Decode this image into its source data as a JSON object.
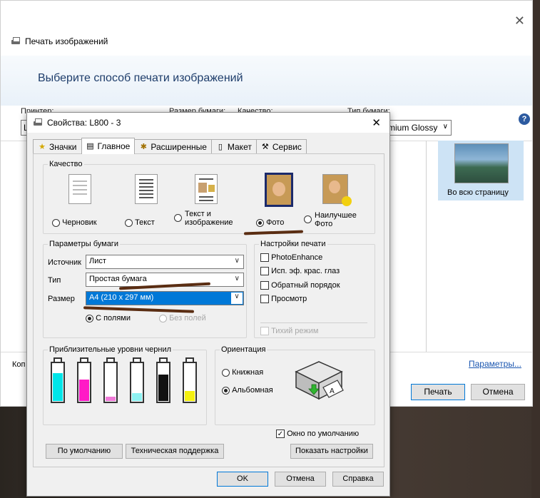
{
  "back_window": {
    "title": "Печать изображений",
    "heading": "Выберите способ печати изображений",
    "labels": {
      "printer": "Принтер:",
      "paper_size": "Размер бумаги:",
      "quality": "Качество:",
      "paper_type": "Тип бумаги:"
    },
    "printer_value_partial": "L",
    "paper_type_value": "mium Glossy",
    "layout_option": "Во всю страницу",
    "copies_label": "Коп",
    "params_link": "Параметры...",
    "print_button": "Печать",
    "cancel_button": "Отмена"
  },
  "props": {
    "title": "Свойства: L800 - 3",
    "tabs": [
      "Значки",
      "Главное",
      "Расширенные",
      "Макет",
      "Сервис"
    ],
    "active_tab": "Главное",
    "quality_legend": "Качество",
    "quality_options": [
      "Черновик",
      "Текст",
      "Текст и изображение",
      "Фото",
      "Наилучшее Фото"
    ],
    "quality_selected": "Фото",
    "paper_legend": "Параметры бумаги",
    "source_label": "Источник",
    "source_value": "Лист",
    "type_label": "Тип",
    "type_value": "Простая бумага",
    "size_label": "Размер",
    "size_value": "A4 (210 x 297 мм)",
    "margins_option": "С полями",
    "borderless_option": "Без полей",
    "print_settings_legend": "Настройки печати",
    "print_settings": [
      "PhotoEnhance",
      "Исп. эф. крас. глаз",
      "Обратный порядок",
      "Просмотр"
    ],
    "quiet_mode": "Тихий режим",
    "ink_legend": "Приблизительные уровни чернил",
    "inks": [
      {
        "color": "#00e5e8",
        "level": 0.72
      },
      {
        "color": "#ff1ac6",
        "level": 0.55
      },
      {
        "color": "#f07ad8",
        "level": 0.12
      },
      {
        "color": "#8ef2f2",
        "level": 0.2
      },
      {
        "color": "#111111",
        "level": 0.68
      },
      {
        "color": "#f4f010",
        "level": 0.25
      }
    ],
    "orientation_legend": "Ориентация",
    "portrait": "Книжная",
    "landscape": "Альбомная",
    "default_window": "Окно по умолчанию",
    "defaults_button": "По умолчанию",
    "support_button": "Техническая поддержка",
    "show_settings_button": "Показать настройки",
    "ok_button": "OK",
    "cancel_button": "Отмена",
    "help_button": "Справка"
  }
}
